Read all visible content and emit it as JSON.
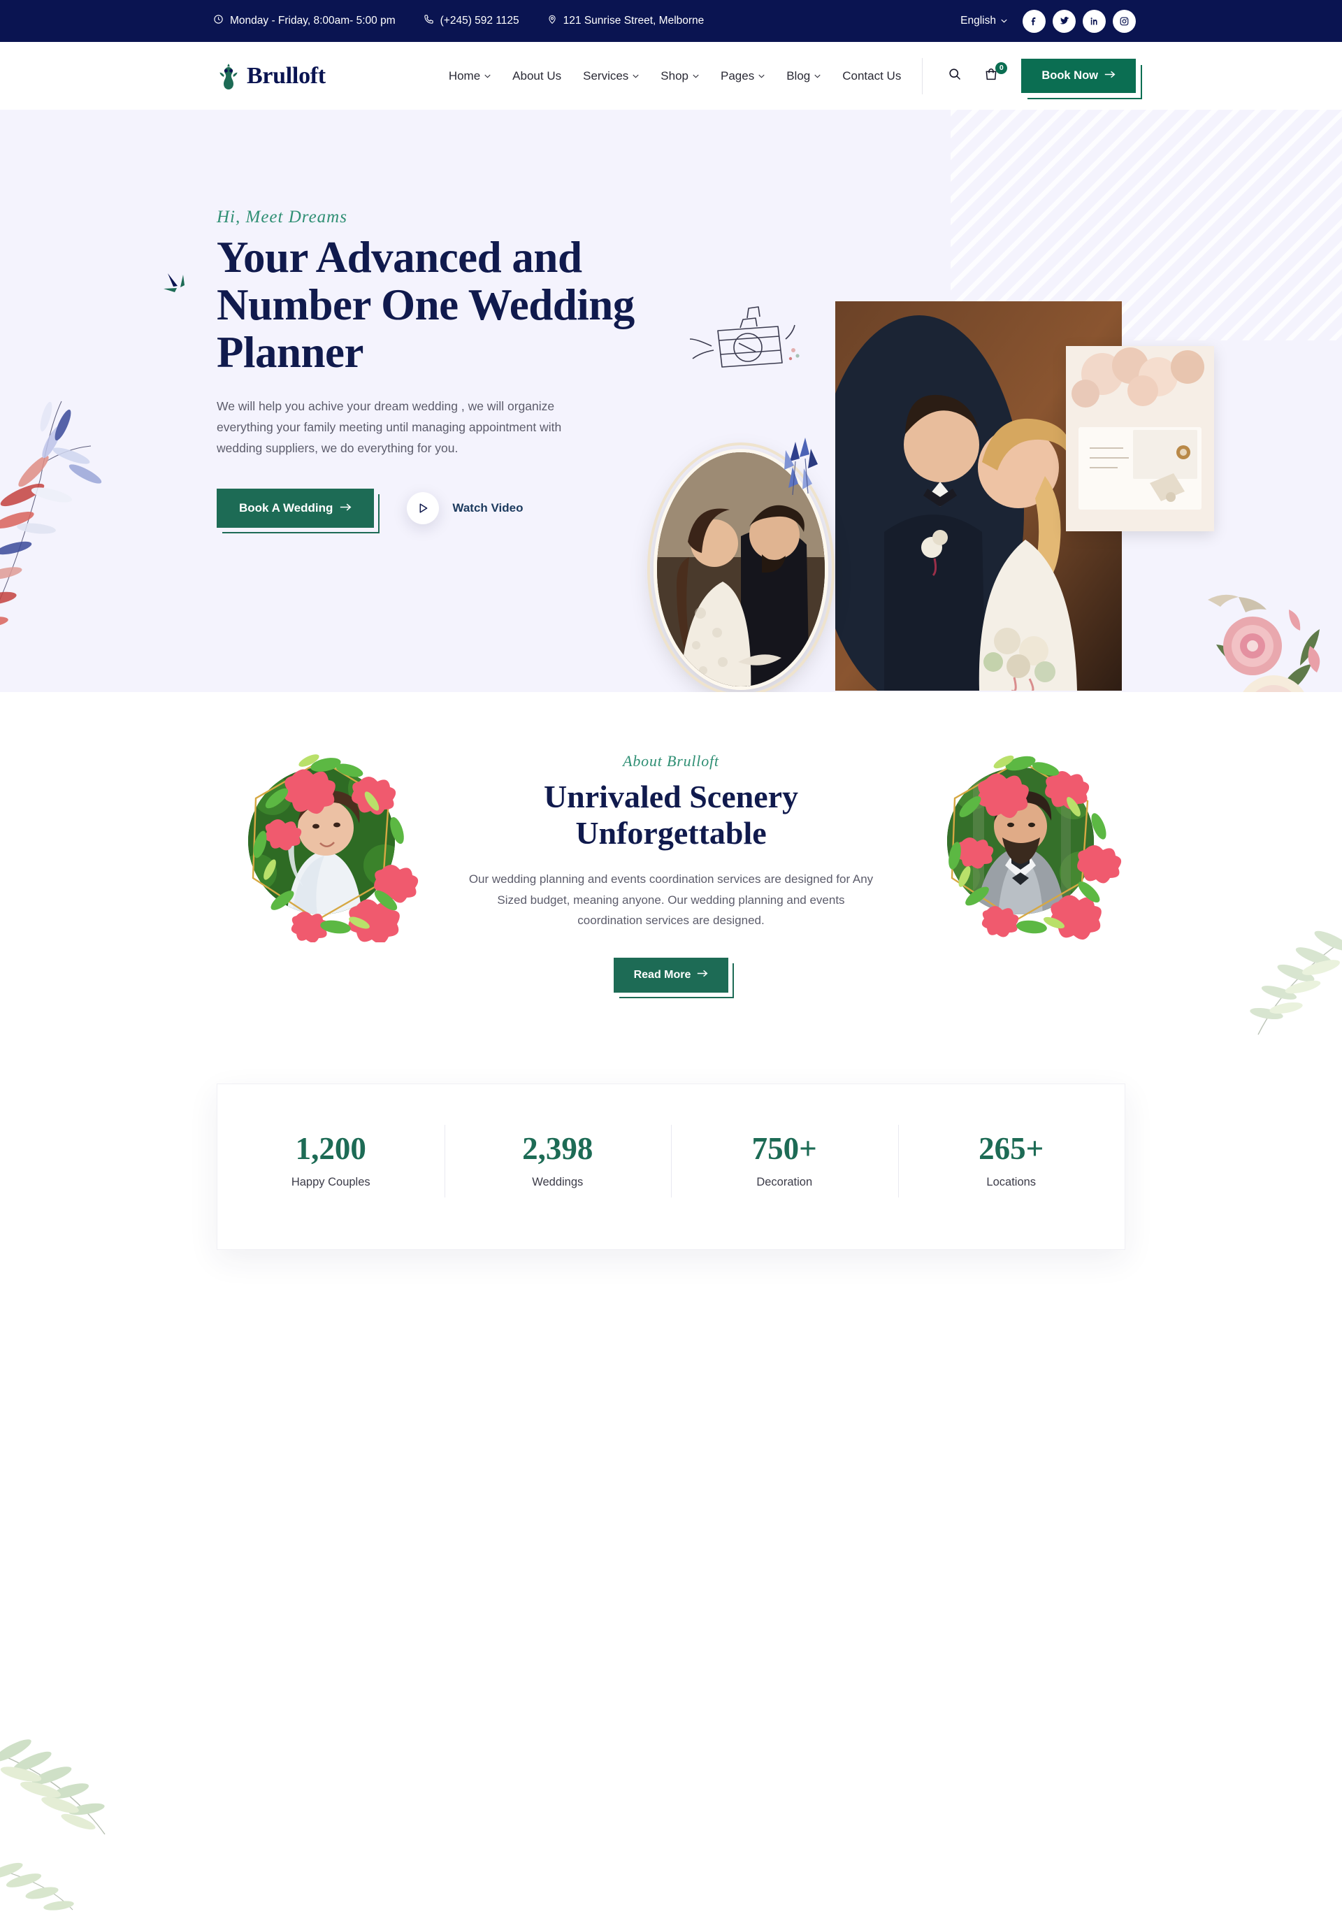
{
  "topbar": {
    "hours": "Monday - Friday, 8:00am- 5:00 pm",
    "phone": "(+245) 592 1125",
    "address": "121 Sunrise Street, Melborne",
    "language": "English",
    "socials": [
      "facebook-icon",
      "twitter-icon",
      "linkedin-icon",
      "instagram-icon"
    ]
  },
  "header": {
    "brand": "Brulloft",
    "nav": [
      {
        "label": "Home",
        "caret": true
      },
      {
        "label": "About Us",
        "caret": false
      },
      {
        "label": "Services",
        "caret": true
      },
      {
        "label": "Shop",
        "caret": true
      },
      {
        "label": "Pages",
        "caret": true
      },
      {
        "label": "Blog",
        "caret": true
      },
      {
        "label": "Contact Us",
        "caret": false
      }
    ],
    "cart_count": "0",
    "book_now": "Book Now"
  },
  "hero": {
    "eyebrow": "Hi, Meet Dreams",
    "title": "Your Advanced and Number One Wedding Planner",
    "description": "We will help you achive your dream wedding , we will organize everything your family meeting until managing appointment with wedding suppliers, we do everything for you.",
    "primary_button": "Book A Wedding",
    "video_button": "Watch Video"
  },
  "about": {
    "eyebrow": "About Brulloft",
    "title": "Unrivaled Scenery Unforgettable",
    "description": "Our wedding planning and events coordination services are designed for Any Sized budget, meaning anyone. Our wedding planning and events coordination services are designed.",
    "button": "Read More"
  },
  "stats": [
    {
      "value": "1,200",
      "label": "Happy Couples"
    },
    {
      "value": "2,398",
      "label": "Weddings"
    },
    {
      "value": "750+",
      "label": "Decoration"
    },
    {
      "value": "265+",
      "label": "Locations"
    }
  ],
  "colors": {
    "navy": "#0a1451",
    "green": "#1d6b55",
    "accent_script": "#2f8f74",
    "hero_bg": "#f4f3fd"
  }
}
